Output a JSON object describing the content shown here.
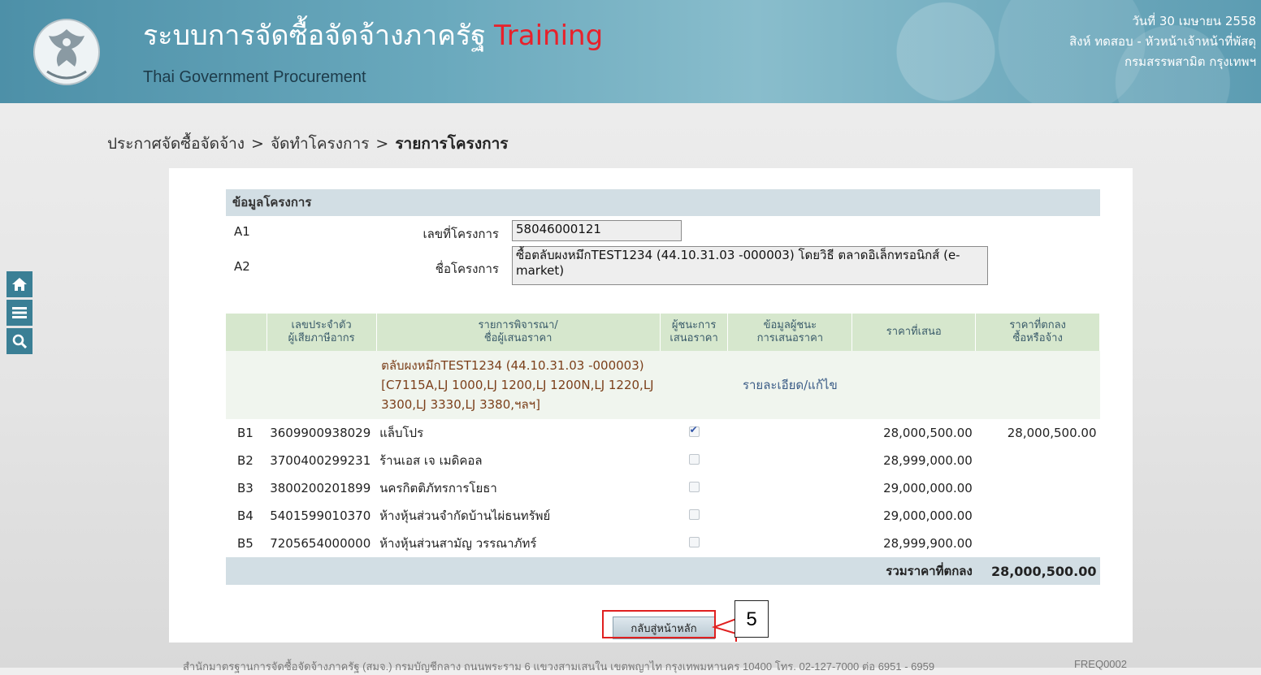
{
  "header": {
    "title": "ระบบการจัดซื้อจัดจ้างภาครัฐ",
    "title_suffix": "Training",
    "subtitle": "Thai Government Procurement",
    "date": "วันที่ 30 เมษายน 2558",
    "user": "สิงห์ ทดสอบ - หัวหน้าเจ้าหน้าที่พัสดุ",
    "org": "กรมสรรพสามิต กรุงเทพฯ"
  },
  "breadcrumb": {
    "items": [
      "ประกาศจัดซื้อจัดจ้าง",
      "จัดทำโครงการ"
    ],
    "separator": ">",
    "current": "รายการโครงการ"
  },
  "side_icons": [
    "home-icon",
    "menu-icon",
    "search-icon"
  ],
  "project": {
    "section_title": "ข้อมูลโครงการ",
    "fields": [
      {
        "code": "A1",
        "label": "เลขที่โครงการ",
        "value": "58046000121"
      },
      {
        "code": "A2",
        "label": "ชื่อโครงการ",
        "value": "ซื้อตลับผงหมึกTEST1234 (44.10.31.03 -000003) โดยวิธี ตลาดอิเล็กทรอนิกส์ (e-market)"
      }
    ]
  },
  "table": {
    "headers": {
      "tax_id_1": "เลขประจำตัว",
      "tax_id_2": "ผู้เสียภาษีอากร",
      "item_1": "รายการพิจารณา/",
      "item_2": "ชื่อผู้เสนอราคา",
      "winner_1": "ผู้ชนะการ",
      "winner_2": "เสนอราคา",
      "winner_info_1": "ข้อมูลผู้ชนะ",
      "winner_info_2": "การเสนอราคา",
      "offer_price": "ราคาที่เสนอ",
      "agreed_1": "ราคาที่ตกลง",
      "agreed_2": "ซื้อหรือจ้าง"
    },
    "item_description": "ตลับผงหมึกTEST1234 (44.10.31.03 -000003)[C7115A,LJ 1000,LJ 1200,LJ 1200N,LJ 1220,LJ 3300,LJ 3330,LJ 3380,ฯลฯ]",
    "detail_link": "รายละเอียด/แก้ไข",
    "rows": [
      {
        "code": "B1",
        "tax_id": "3609900938029",
        "name": "แล็บโปร",
        "winner": true,
        "offer": "28,000,500.00",
        "agreed": "28,000,500.00"
      },
      {
        "code": "B2",
        "tax_id": "3700400299231",
        "name": "ร้านเอส เจ เมดิคอล",
        "winner": false,
        "offer": "28,999,000.00",
        "agreed": ""
      },
      {
        "code": "B3",
        "tax_id": "3800200201899",
        "name": "นครกิตติภัทรการโยธา",
        "winner": false,
        "offer": "29,000,000.00",
        "agreed": ""
      },
      {
        "code": "B4",
        "tax_id": "5401599010370",
        "name": "ห้างหุ้นส่วนจำกัดบ้านไผ่ธนทรัพย์",
        "winner": false,
        "offer": "29,000,000.00",
        "agreed": ""
      },
      {
        "code": "B5",
        "tax_id": "7205654000000",
        "name": "ห้างหุ้นส่วนสามัญ วรรณาภัทร์",
        "winner": false,
        "offer": "28,999,900.00",
        "agreed": ""
      }
    ],
    "total_label": "รวมราคาที่ตกลง",
    "total_value": "28,000,500.00"
  },
  "back_button": "กลับสู่หน้าหลัก",
  "annotation_number": "5",
  "footer": {
    "text": "สำนักมาตรฐานการจัดซื้อจัดจ้างภาครัฐ (สมจ.) กรมบัญชีกลาง ถนนพระราม 6 แขวงสามเสนใน เขตพญาไท กรุงเทพมหานคร 10400 โทร. 02-127-7000 ต่อ 6951 - 6959",
    "code": "FREQ0002"
  },
  "colors": {
    "header_bg": "#5c9cb2",
    "training_red": "#e8212b",
    "table_header_bg": "#d6e7cd",
    "section_bg": "#d2dee4",
    "annotation_red": "#e02020"
  }
}
